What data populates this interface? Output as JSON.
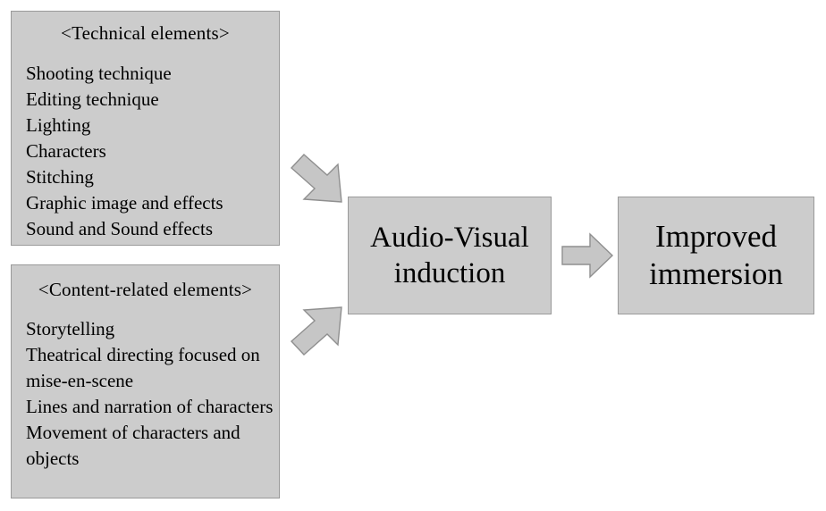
{
  "diagram": {
    "title": "Audio-Visual induction leading to improved immersion",
    "colors": {
      "box_fill": "#cccccc",
      "box_border": "#9a9a9a",
      "arrow_fill": "#c6c6c6",
      "arrow_border": "#8f8f8f",
      "background": "#ffffff",
      "text": "#000000"
    }
  },
  "panels": [
    {
      "id": "technical",
      "title": "<Technical elements>",
      "items": [
        "Shooting  technique",
        "Editing technique",
        "Lighting",
        "Characters",
        "Stitching",
        "Graphic image and effects",
        "Sound and Sound effects"
      ]
    },
    {
      "id": "content",
      "title": "<Content-related elements>",
      "items": [
        "Storytelling",
        "Theatrical directing focused on mise-en-scene",
        "Lines and narration of characters",
        "Movement of characters and objects"
      ]
    }
  ],
  "process": {
    "induction": "Audio-Visual induction",
    "immersion": "Improved immersion"
  },
  "arrows": [
    {
      "id": "technical-to-induction",
      "icon": "block-arrow-down-right",
      "direction": "down-right"
    },
    {
      "id": "content-to-induction",
      "icon": "block-arrow-up-right",
      "direction": "up-right"
    },
    {
      "id": "induction-to-immersion",
      "icon": "block-arrow-right",
      "direction": "right"
    }
  ]
}
